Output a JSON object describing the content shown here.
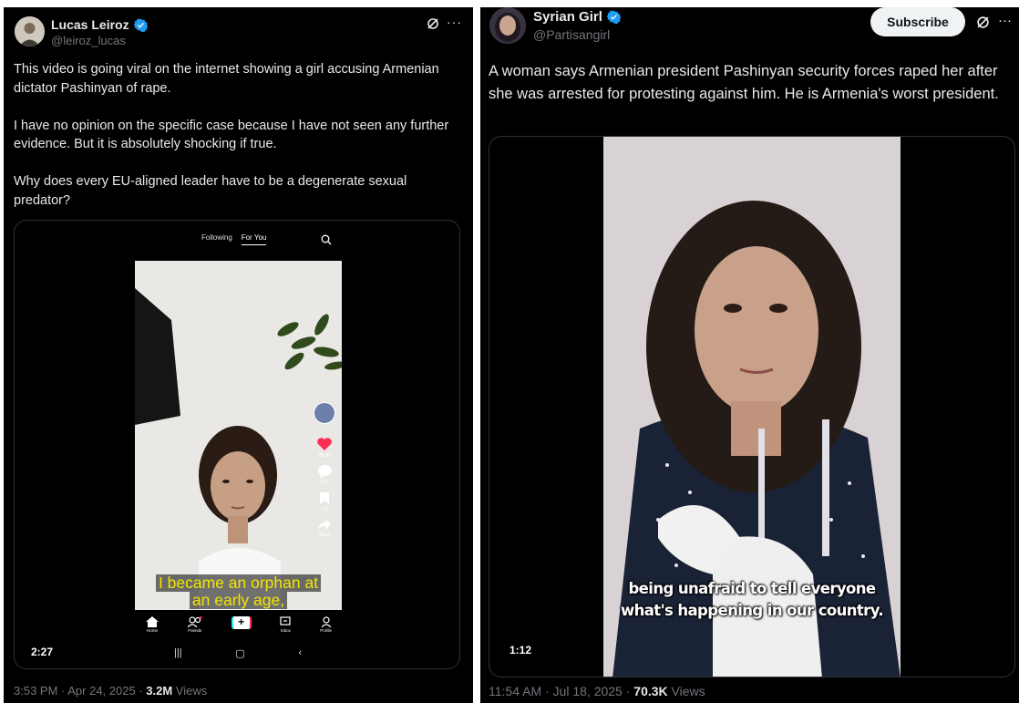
{
  "left": {
    "author": "Lucas Leiroz",
    "handle": "@leiroz_lucas",
    "paragraphs": [
      "This video is going viral on the internet showing a girl accusing Armenian dictator Pashinyan of rape.",
      "I have no opinion on the specific case because I have not seen any further evidence. But it is absolutely shocking if true.",
      "Why does every EU-aligned leader have to be a degenerate sexual predator?"
    ],
    "video": {
      "tabs": {
        "following": "Following",
        "for_you": "For You"
      },
      "caption_line1": "I became an orphan at",
      "caption_line2": "an early age,",
      "side_counts": {
        "likes": "85.2K",
        "comments": "227",
        "saves": "715",
        "share": "Share"
      },
      "bottom_nav": {
        "home": "Home",
        "friends": "Friends",
        "inbox": "Inbox",
        "profile": "Profile"
      },
      "duration": "2:27"
    },
    "meta": {
      "time": "3:53 PM · Apr 24, 2025 · ",
      "views_count": "3.2M",
      "views_label": " Views"
    }
  },
  "right": {
    "author": "Syrian Girl",
    "handle": "@Partisangirl",
    "subscribe_label": "Subscribe",
    "text": "A woman says Armenian president Pashinyan security forces raped her after she was arrested for protesting against him. He is Armenia's worst president.",
    "video": {
      "caption_line1": "being unafraid to tell everyone",
      "caption_line2": "what's happening in our country.",
      "duration": "1:12"
    },
    "meta": {
      "time": "11:54 AM · Jul 18, 2025 · ",
      "views_count": "70.3K",
      "views_label": " Views"
    }
  },
  "colors": {
    "background": "#000000",
    "text": "#e7e9ea",
    "muted": "#71767b",
    "verified": "#1d9bf0",
    "border": "#2f3336",
    "caption_yellow": "#f3e600"
  },
  "icons": [
    "verified-badge-icon",
    "grok-icon",
    "more-icon",
    "search-icon",
    "heart-icon",
    "comment-icon",
    "bookmark-icon",
    "share-icon",
    "home-icon",
    "friends-icon",
    "create-icon",
    "inbox-icon",
    "profile-icon"
  ]
}
